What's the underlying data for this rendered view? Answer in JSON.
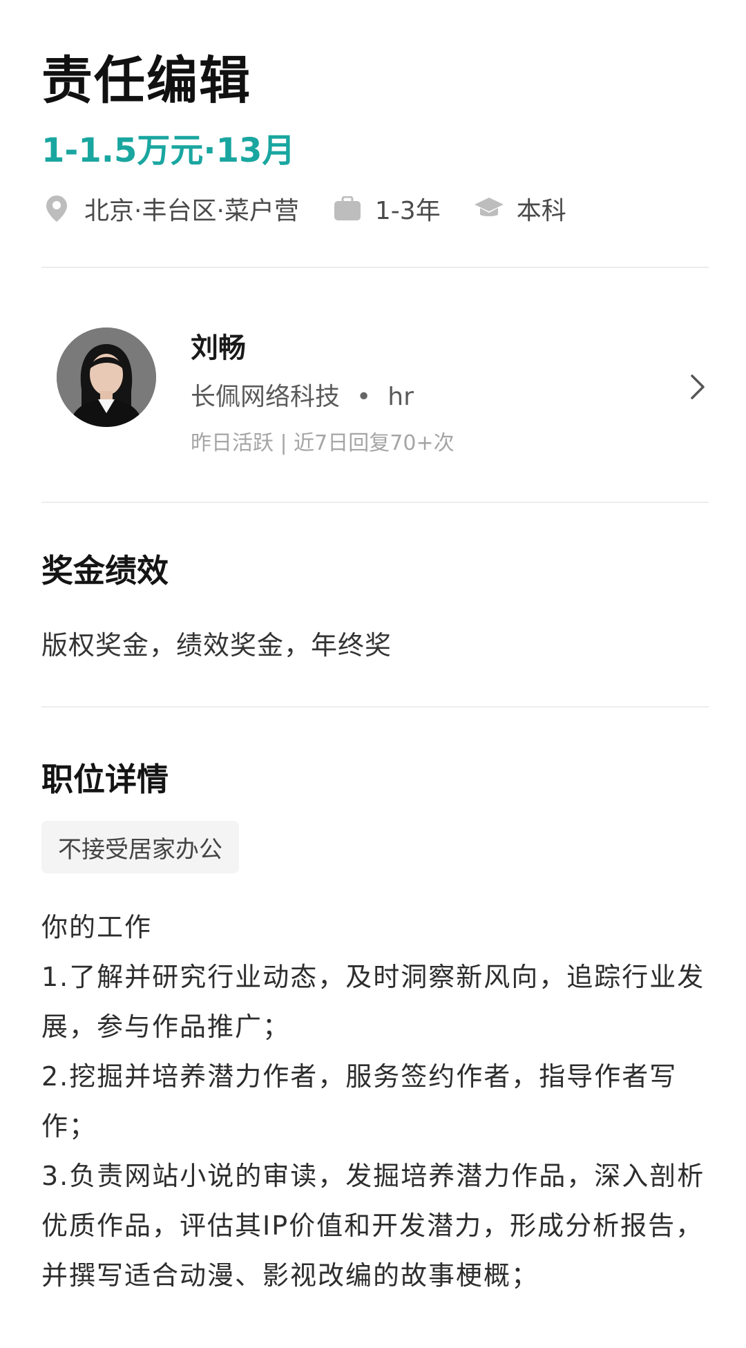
{
  "job": {
    "title": "责任编辑",
    "salary": "1-1.5万元·13月",
    "location": "北京·丰台区·菜户营",
    "experience": "1-3年",
    "education": "本科"
  },
  "recruiter": {
    "name": "刘畅",
    "company": "长佩网络科技",
    "separator": "•",
    "role": "hr",
    "activity": "昨日活跃 | 近7日回复70+次"
  },
  "bonus": {
    "heading": "奖金绩效",
    "text": "版权奖金，绩效奖金，年终奖"
  },
  "details": {
    "heading": "职位详情",
    "tag": "不接受居家办公",
    "lines": [
      "你的工作",
      "1.了解并研究行业动态，及时洞察新风向，追踪行业发展，参与作品推广；",
      "2.挖掘并培养潜力作者，服务签约作者，指导作者写作；",
      "3.负责网站小说的审读，发掘培养潜力作品，深入剖析优质作品，评估其IP价值和开发潜力，形成分析报告，并撰写适合动漫、影视改编的故事梗概；"
    ]
  },
  "colors": {
    "salary": "#1aa6a0",
    "icon": "#bdbdbd",
    "divider": "#ececec",
    "tag_bg": "#f4f4f4"
  },
  "icons": [
    "location-pin-icon",
    "briefcase-icon",
    "graduation-cap-icon",
    "chevron-right-icon"
  ]
}
